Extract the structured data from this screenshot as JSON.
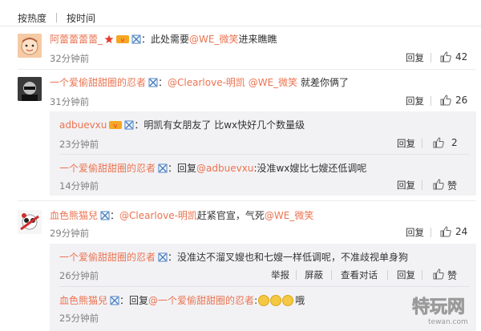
{
  "tabs": {
    "hot": "按热度",
    "time": "按时间"
  },
  "actions": {
    "reply": "回复",
    "report": "举报",
    "block": "屏蔽",
    "view_dialog": "查看对话"
  },
  "comments": [
    {
      "user": "阿蕾蕾蕾蕾_",
      "sep": "：",
      "text_before": "此处需要",
      "mention": "@WE_微笑",
      "text_after": " 进来瞧瞧",
      "time": "32分钟前",
      "likes": "42"
    },
    {
      "user": "一个爱偷甜甜圈的忍者",
      "sep": "：",
      "mention1": "@Clearlove-明凯",
      "mention2": "@WE_微笑",
      "text_after": "就差你俩了",
      "time": "31分钟前",
      "likes": "26",
      "replies": [
        {
          "user": "adbuevxu",
          "sep": "：",
          "text": "明凯有女朋友了 比wx快好几个数量级",
          "time": "23分钟前",
          "likes": "2"
        },
        {
          "user": "一个爱偷甜甜圈的忍者",
          "sep": "：",
          "prefix": "回复",
          "mention": "@adbuevxu",
          "text": ":没准wx嫂比七嫂还低调呢",
          "time": "14分钟前",
          "likes": "赞"
        }
      ]
    },
    {
      "user": "血色熊猫兒",
      "sep": "：",
      "mention1": "@Clearlove-明凯",
      "text_mid": " 赶紧官宣，气死",
      "mention2": "@WE_微笑",
      "time": "29分钟前",
      "likes": "24",
      "replies": [
        {
          "user": "一个爱偷甜甜圈的忍者",
          "sep": "：",
          "text": "没准达不溜叉嫂也和七嫂一样低调呢，不准歧视单身狗",
          "time": "26分钟前",
          "likes": "赞"
        },
        {
          "user": "血色熊猫兒",
          "sep": "：",
          "prefix": "回复",
          "mention": "@一个爱偷甜甜圈的忍者",
          "text_after": "哦",
          "time": "25分钟前"
        }
      ]
    }
  ],
  "icons": {
    "star": "star-icon",
    "vip": "vip-badge-icon",
    "fans": "fan-badge-icon",
    "like": "thumbs-up-icon",
    "emoji": "emoji-face-icon"
  },
  "colors": {
    "username": "#eb7350",
    "text": "#333333",
    "meta": "#808080",
    "subbox": "#f2f2f5"
  },
  "watermark": {
    "text": "特玩网",
    "domain": "tewan.com"
  }
}
